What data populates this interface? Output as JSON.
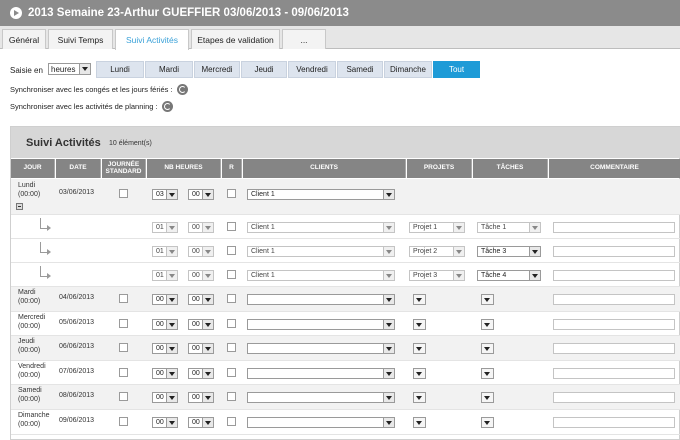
{
  "title": "2013 Semaine 23-Arthur GUEFFIER 03/06/2013 - 09/06/2013",
  "tabs": [
    "Général",
    "Suivi Temps",
    "Suivi Activités",
    "Etapes de validation",
    "..."
  ],
  "saisie": {
    "label": "Saisie en",
    "value": "heures"
  },
  "days": [
    "Lundi",
    "Mardi",
    "Mercredi",
    "Jeudi",
    "Vendredi",
    "Samedi",
    "Dimanche",
    "Tout"
  ],
  "sync": {
    "conges": "Synchroniser avec les congés et les jours fériés :",
    "planning": "Synchroniser avec les activités de planning :"
  },
  "panel": {
    "title": "Suivi Activités",
    "count": "10 élément(s)"
  },
  "columns": {
    "jour": "JOUR",
    "date": "DATE",
    "journee": "JOURNÉE STANDARD",
    "nb_heures": "NB HEURES",
    "r": "R",
    "clients": "CLIENTS",
    "projets": "PROJETS",
    "taches": "TÂCHES",
    "commentaire": "COMMENTAIRE"
  },
  "rows": {
    "lundi": {
      "day": "Lundi",
      "time": "(00:00)",
      "date": "03/06/2013",
      "h": "03",
      "m": "00",
      "client": "Client 1"
    },
    "sub1": {
      "h": "01",
      "m": "00",
      "client": "Client 1",
      "projet": "Projet 1",
      "tache": "Tâche 1"
    },
    "sub2": {
      "h": "01",
      "m": "00",
      "client": "Client 1",
      "projet": "Projet 2",
      "tache": "Tâche 3"
    },
    "sub3": {
      "h": "01",
      "m": "00",
      "client": "Client 1",
      "projet": "Projet 3",
      "tache": "Tâche 4"
    },
    "mardi": {
      "day": "Mardi",
      "time": "(00:00)",
      "date": "04/06/2013",
      "h": "00",
      "m": "00"
    },
    "mercredi": {
      "day": "Mercredi",
      "time": "(00:00)",
      "date": "05/06/2013",
      "h": "00",
      "m": "00"
    },
    "jeudi": {
      "day": "Jeudi",
      "time": "(00:00)",
      "date": "06/06/2013",
      "h": "00",
      "m": "00"
    },
    "vendredi": {
      "day": "Vendredi",
      "time": "(00:00)",
      "date": "07/06/2013",
      "h": "00",
      "m": "00"
    },
    "samedi": {
      "day": "Samedi",
      "time": "(00:00)",
      "date": "08/06/2013",
      "h": "00",
      "m": "00"
    },
    "dimanche": {
      "day": "Dimanche",
      "time": "(00:00)",
      "date": "09/06/2013",
      "h": "00",
      "m": "00"
    }
  }
}
